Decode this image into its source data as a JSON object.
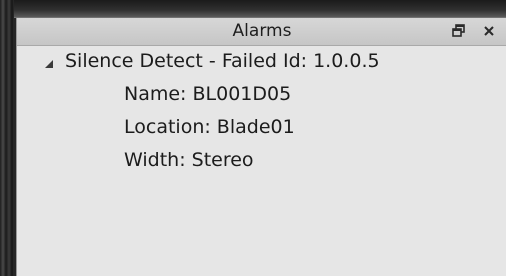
{
  "panel": {
    "title": "Alarms",
    "float_icon": "float-window-icon",
    "close_icon": "close-icon"
  },
  "alarm": {
    "heading": "Silence Detect - Failed Id: 1.0.0.5",
    "expanded": true,
    "details": [
      "Name: BL001D05",
      "Location: Blade01",
      "Width: Stereo"
    ]
  }
}
